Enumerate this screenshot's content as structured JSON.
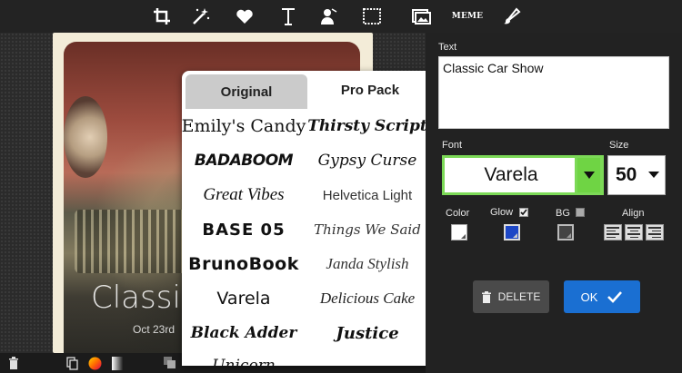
{
  "toolbar": {
    "icons": [
      "crop-icon",
      "magic-wand-icon",
      "heart-icon",
      "text-icon",
      "stamp-icon",
      "frame-icon",
      "photo-icon",
      "meme-icon",
      "brush-icon"
    ],
    "meme_label": "MEME"
  },
  "canvas": {
    "title_text": "Classic",
    "subtitle_text": "Oct 23rd"
  },
  "font_panel": {
    "tabs": {
      "original": "Original",
      "pro_pack": "Pro Pack"
    },
    "fonts_left": [
      "Emily's Candy",
      "BADABOOM",
      "Great Vibes",
      "BASE 05",
      "BrunoBook",
      "Varela",
      "Black Adder",
      "Unicorn"
    ],
    "fonts_right": [
      "Thirsty Script",
      "Gypsy Curse",
      "Helvetica Light",
      "Things We Said",
      "Janda Stylish",
      "Delicious Cake",
      "Justice"
    ]
  },
  "right_panel": {
    "text_label": "Text",
    "text_value": "Classic Car Show",
    "font_label": "Font",
    "font_value": "Varela",
    "size_label": "Size",
    "size_value": "50",
    "color_label": "Color",
    "glow_label": "Glow",
    "bg_label": "BG",
    "align_label": "Align",
    "glow_checked": true,
    "bg_checked": false,
    "delete_label": "DELETE",
    "ok_label": "OK",
    "colors": {
      "text_color": "#ffffff",
      "glow_color": "#1d47c6",
      "bg_color": "#444444",
      "accent_green": "#7cd957",
      "ok_blue": "#1a6fd2"
    }
  }
}
